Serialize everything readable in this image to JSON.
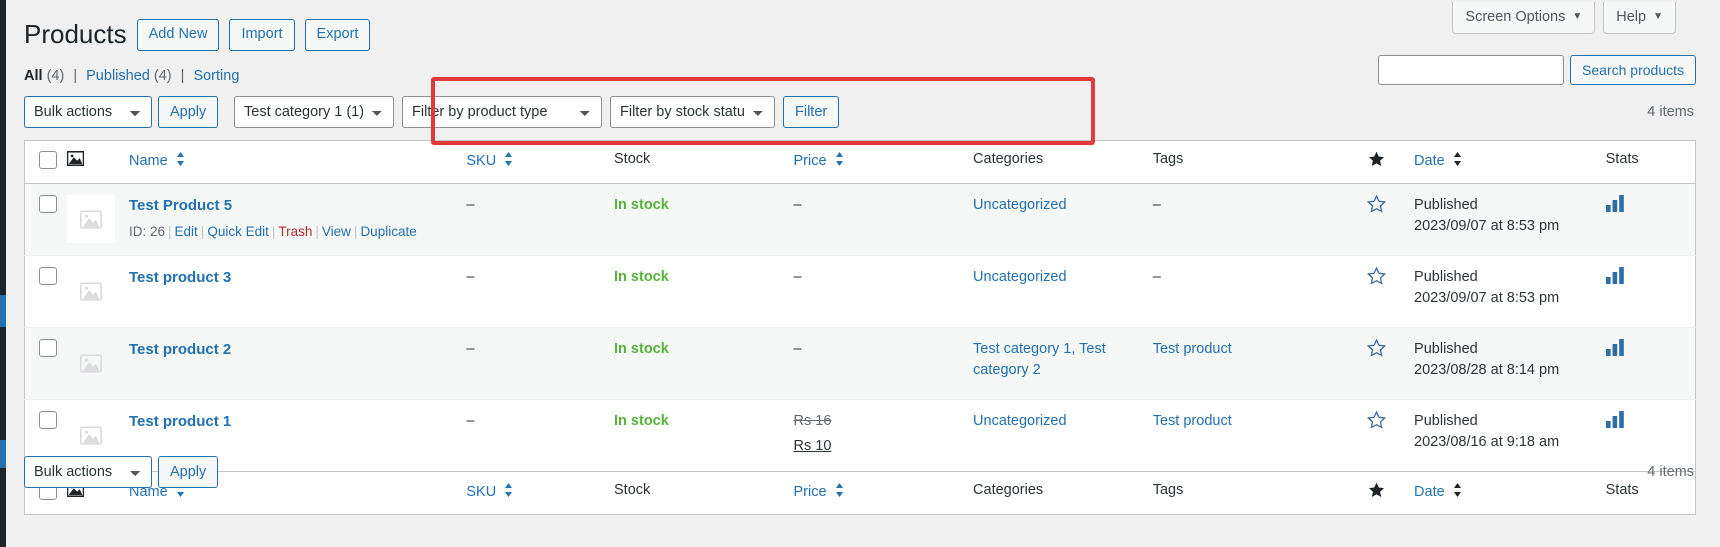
{
  "screen_meta": {
    "screen_options_label": "Screen Options",
    "help_label": "Help",
    "caret": "▼"
  },
  "header": {
    "page_title": "Products",
    "actions": [
      {
        "label": "Add New",
        "name": "add-new-button"
      },
      {
        "label": "Import",
        "name": "import-button"
      },
      {
        "label": "Export",
        "name": "export-button"
      }
    ]
  },
  "status_links": {
    "all_label": "All",
    "all_count": "(4)",
    "published_label": "Published",
    "published_count": "(4)",
    "sorting_label": "Sorting",
    "separator": "|"
  },
  "search": {
    "value": "",
    "placeholder": "",
    "button_label": "Search products"
  },
  "tablenav": {
    "bulk_actions_label": "Bulk actions",
    "apply_label": "Apply",
    "filter_button_label": "Filter",
    "category_filter_label": "Test category 1  (1)",
    "product_type_filter_label": "Filter by product type",
    "stock_status_filter_label": "Filter by stock status",
    "items_count_top": "4 items",
    "items_count_bottom": "4 items"
  },
  "table": {
    "columns": [
      {
        "label": "",
        "name": "select-all-column",
        "sortable": false
      },
      {
        "label": "",
        "name": "thumbnail-column",
        "sortable": false
      },
      {
        "label": "Name",
        "name": "name-column",
        "sortable": true
      },
      {
        "label": "SKU",
        "name": "sku-column",
        "sortable": true
      },
      {
        "label": "Stock",
        "name": "stock-column",
        "sortable": false
      },
      {
        "label": "Price",
        "name": "price-column",
        "sortable": true
      },
      {
        "label": "Categories",
        "name": "categories-column",
        "sortable": false
      },
      {
        "label": "Tags",
        "name": "tags-column",
        "sortable": false
      },
      {
        "label": "",
        "name": "featured-column",
        "sortable": false
      },
      {
        "label": "Date",
        "name": "date-column",
        "sortable": true
      },
      {
        "label": "Stats",
        "name": "stats-column",
        "sortable": false
      }
    ],
    "rows": [
      {
        "title": "Test Product 5",
        "id_label": "ID: 26",
        "actions": [
          "Edit",
          "Quick Edit",
          "Trash",
          "View",
          "Duplicate"
        ],
        "sku": "–",
        "stock": "In stock",
        "price_regular": "",
        "price_sale": "",
        "price_plain": "–",
        "categories": "Uncategorized",
        "tags": "–",
        "date_status": "Published",
        "date_value": "2023/09/07 at 8:53 pm",
        "has_actions": true,
        "thumb_boxed": true
      },
      {
        "title": "Test product 3",
        "id_label": "",
        "actions": [],
        "sku": "–",
        "stock": "In stock",
        "price_regular": "",
        "price_sale": "",
        "price_plain": "–",
        "categories": "Uncategorized",
        "tags": "–",
        "date_status": "Published",
        "date_value": "2023/09/07 at 8:53 pm",
        "has_actions": false,
        "thumb_boxed": false
      },
      {
        "title": "Test product 2",
        "id_label": "",
        "actions": [],
        "sku": "–",
        "stock": "In stock",
        "price_regular": "",
        "price_sale": "",
        "price_plain": "–",
        "categories": "Test category 1, Test category 2",
        "tags": "Test product",
        "date_status": "Published",
        "date_value": "2023/08/28 at 8:14 pm",
        "has_actions": false,
        "thumb_boxed": false
      },
      {
        "title": "Test product 1",
        "id_label": "",
        "actions": [],
        "sku": "–",
        "stock": "In stock",
        "price_regular": "Rs 16",
        "price_sale": "Rs 10",
        "price_plain": "",
        "categories": "Uncategorized",
        "tags": "Test product",
        "date_status": "Published",
        "date_value": "2023/08/16 at 9:18 am",
        "has_actions": true,
        "thumb_boxed": false
      }
    ]
  },
  "colors": {
    "link": "#2271b1",
    "in_stock": "#57b33c",
    "trash": "#b32d2e",
    "highlight": "#e03a3a",
    "stats_bar": "#2271b1"
  },
  "icons": {
    "thumbnail": "image-placeholder-icon",
    "featured_header": "star-filled-icon",
    "featured_row": "star-outline-icon",
    "stats": "bar-chart-icon",
    "sort": "sort-arrows-icon"
  }
}
